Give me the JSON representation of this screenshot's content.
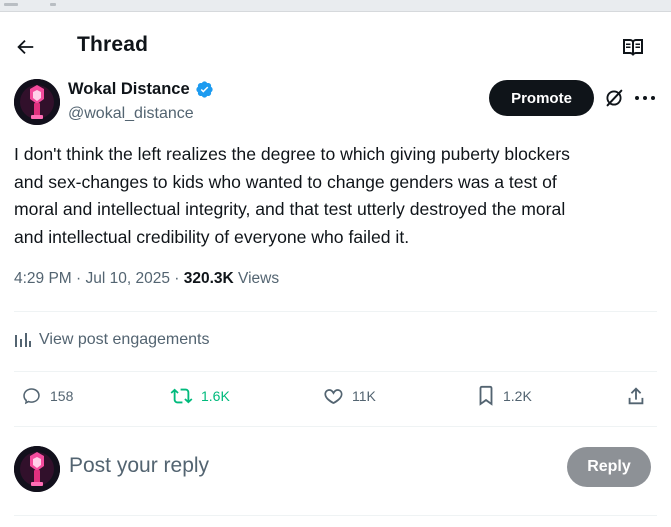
{
  "header": {
    "title": "Thread"
  },
  "post": {
    "author_name": "Wokal Distance",
    "author_handle": "@wokal_distance",
    "promote_label": "Promote",
    "text_lines": [
      "I don't think the left realizes the degree to which giving puberty blockers",
      "and sex-changes to kids who wanted to change genders was a test of",
      "moral and intellectual integrity, and that test utterly destroyed the moral",
      "and intellectual credibility of everyone who failed it."
    ],
    "timestamp": "4:29 PM · Jul 10, 2025",
    "meta_separator": " · ",
    "views_count": "320.3K",
    "views_label": " Views",
    "engagements_label": "View post engagements"
  },
  "actions": {
    "replies": "158",
    "reposts": "1.6K",
    "likes": "11K",
    "bookmarks": "1.2K"
  },
  "reply_box": {
    "placeholder": "Post your reply",
    "button_label": "Reply"
  },
  "colors": {
    "accent_blue": "#1d9bf0",
    "repost_green": "#00ba7c",
    "muted_text": "#536471",
    "primary_text": "#0f1419"
  },
  "icons": [
    "back-arrow-icon",
    "reader-icon",
    "verified-badge-icon",
    "grok-icon",
    "more-icon",
    "analytics-icon",
    "reply-icon",
    "repost-icon",
    "like-icon",
    "bookmark-icon",
    "share-icon"
  ]
}
